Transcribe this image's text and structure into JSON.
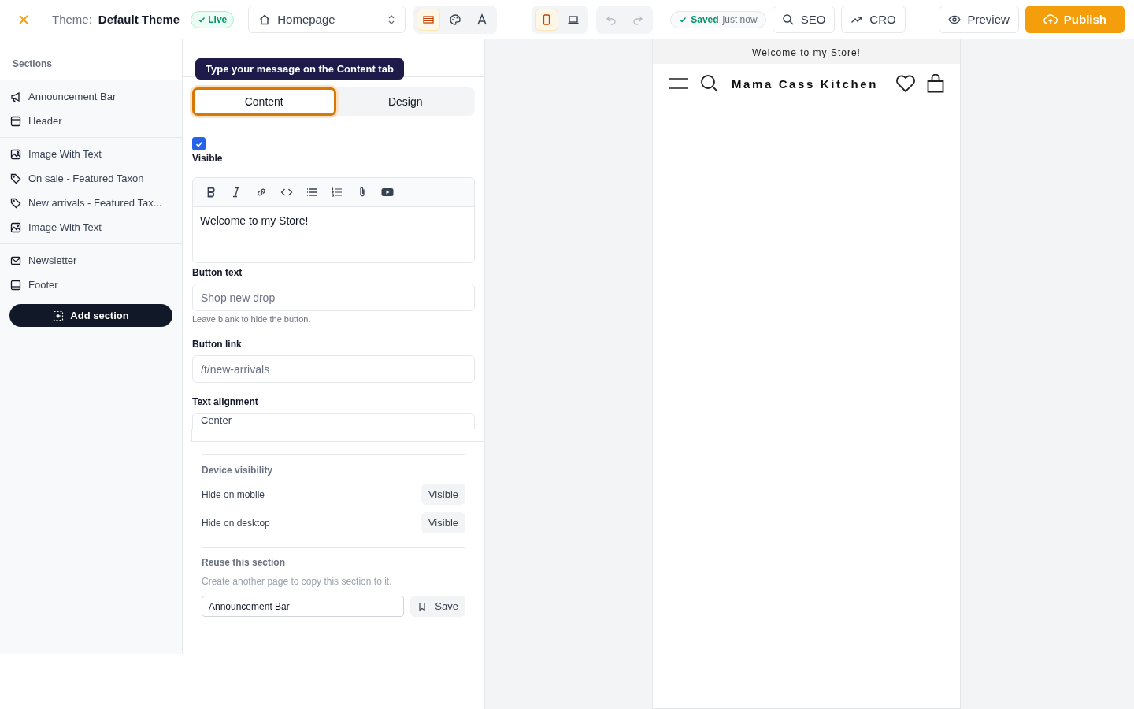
{
  "topbar": {
    "theme_label": "Theme:",
    "theme_name": "Default Theme",
    "status_badge": "Live",
    "page_select": "Homepage",
    "modes": [
      {
        "kind": "sections",
        "selected": true
      },
      {
        "kind": "palette",
        "selected": false
      },
      {
        "kind": "typography",
        "selected": false
      }
    ],
    "devices": [
      {
        "kind": "mobile",
        "selected": true
      },
      {
        "kind": "desktop",
        "selected": false
      }
    ],
    "undo_enabled": false,
    "redo_enabled": false,
    "save_state": {
      "label": "Saved",
      "time": "just now"
    },
    "buttons": [
      {
        "kind": "seo",
        "label": "SEO"
      },
      {
        "kind": "cro",
        "label": "CRO"
      },
      {
        "kind": "preview",
        "label": "Preview"
      },
      {
        "kind": "publish",
        "label": "Publish"
      }
    ]
  },
  "sidebar": {
    "title": "Sections",
    "groups": [
      [
        {
          "kind": "megaphone",
          "label": "Announcement Bar"
        },
        {
          "kind": "header",
          "label": "Header"
        }
      ],
      [
        {
          "kind": "image",
          "label": "Image With Text"
        },
        {
          "kind": "tag",
          "label": "On sale - Featured Taxon"
        },
        {
          "kind": "tag",
          "label": "New arrivals - Featured Tax..."
        },
        {
          "kind": "image",
          "label": "Image With Text"
        }
      ],
      [
        {
          "kind": "mail",
          "label": "Newsletter"
        },
        {
          "kind": "footer",
          "label": "Footer"
        }
      ]
    ],
    "add_button": "Add section"
  },
  "editor": {
    "tooltip": "Type your message on the Content tab",
    "tabs": [
      {
        "label": "Content",
        "selected": true
      },
      {
        "label": "Design",
        "selected": false
      }
    ],
    "visible": {
      "label": "Visible",
      "checked": true
    },
    "rich_text": {
      "value": "Welcome to my Store!"
    },
    "fields": [
      {
        "label": "Button text",
        "placeholder": "Shop new drop",
        "help": "Leave blank to hide the button."
      },
      {
        "label": "Button link",
        "placeholder": "/t/new-arrivals"
      },
      {
        "label": "Text alignment",
        "value": "Center"
      }
    ],
    "device_visibility": {
      "title": "Device visibility",
      "rows": [
        {
          "label": "Hide on mobile",
          "value": "Visible"
        },
        {
          "label": "Hide on desktop",
          "value": "Visible"
        }
      ]
    },
    "reuse": {
      "title": "Reuse this section",
      "hint": "Create another page to copy this section to it.",
      "value": "Announcement Bar",
      "button": "Save"
    }
  },
  "preview": {
    "announcement": "Welcome to my Store!",
    "store_name": "Mama Cass Kitchen"
  }
}
